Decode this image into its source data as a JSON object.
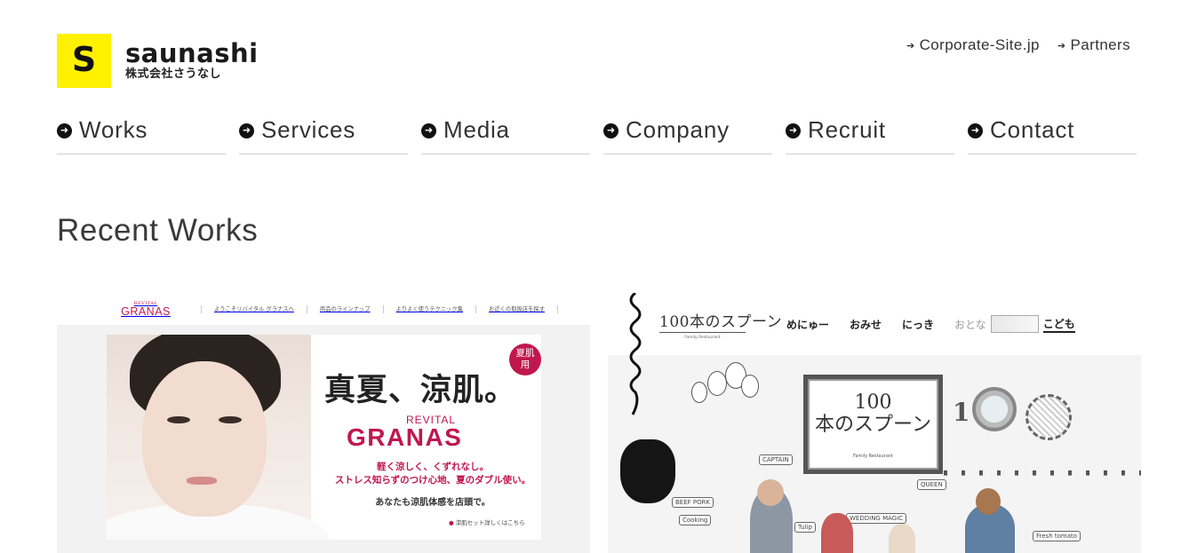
{
  "header": {
    "logo_mark": "S",
    "logo_name": "saunashi",
    "logo_sub": "株式会社さうなし",
    "util_links": [
      {
        "label": "Corporate-Site.jp",
        "icon": "arrow-right-icon"
      },
      {
        "label": "Partners",
        "icon": "arrow-right-icon"
      }
    ]
  },
  "nav": {
    "items": [
      {
        "label": "Works",
        "icon": "circle-arrow-right-icon"
      },
      {
        "label": "Services",
        "icon": "circle-arrow-right-icon"
      },
      {
        "label": "Media",
        "icon": "circle-arrow-right-icon"
      },
      {
        "label": "Company",
        "icon": "circle-arrow-right-icon"
      },
      {
        "label": "Recruit",
        "icon": "circle-arrow-right-icon"
      },
      {
        "label": "Contact",
        "icon": "circle-arrow-right-icon"
      }
    ]
  },
  "section": {
    "title": "Recent Works"
  },
  "works": [
    {
      "brand_small": "REVITAL",
      "brand_big": "GRANAS",
      "menu": [
        "ようこそリバイタル グラナスへ",
        "商品のラインナップ",
        "よりよく使うテクニック集",
        "お近くの取扱店を探す"
      ],
      "headline": "真夏、涼肌。",
      "badge": "夏肌\n用",
      "product_small": "REVITAL",
      "product_big": "GRANAS",
      "copy1": "軽く涼しく、くずれなし。",
      "copy2": "ストレス知らずのつけ心地、夏のダブル使い。",
      "copy3": "あなたも涼肌体感を店頭で。",
      "link": "涼肌セット詳しくはこちら",
      "accent": "#c0174f"
    },
    {
      "logo": "100本のスプーン",
      "logo_sub": "Family Restaurant",
      "menu": [
        "めにゅー",
        "おみせ",
        "にっき"
      ],
      "toggle_left": "おとな",
      "toggle_right": "こども",
      "frame_line1": "100",
      "frame_line2": "本のスプーン",
      "frame_sub": "Family Restaurant",
      "number_one": "1",
      "doodles": [
        "CAPTAIN",
        "QUEEN",
        "BEEF PORK",
        "Cooking",
        "Tulip",
        "WEDDING MAGIC",
        "Fresh tomato"
      ]
    }
  ],
  "colors": {
    "logo_yellow": "#fff100",
    "text": "#333333",
    "nav_underline": "#cfcfcf"
  }
}
